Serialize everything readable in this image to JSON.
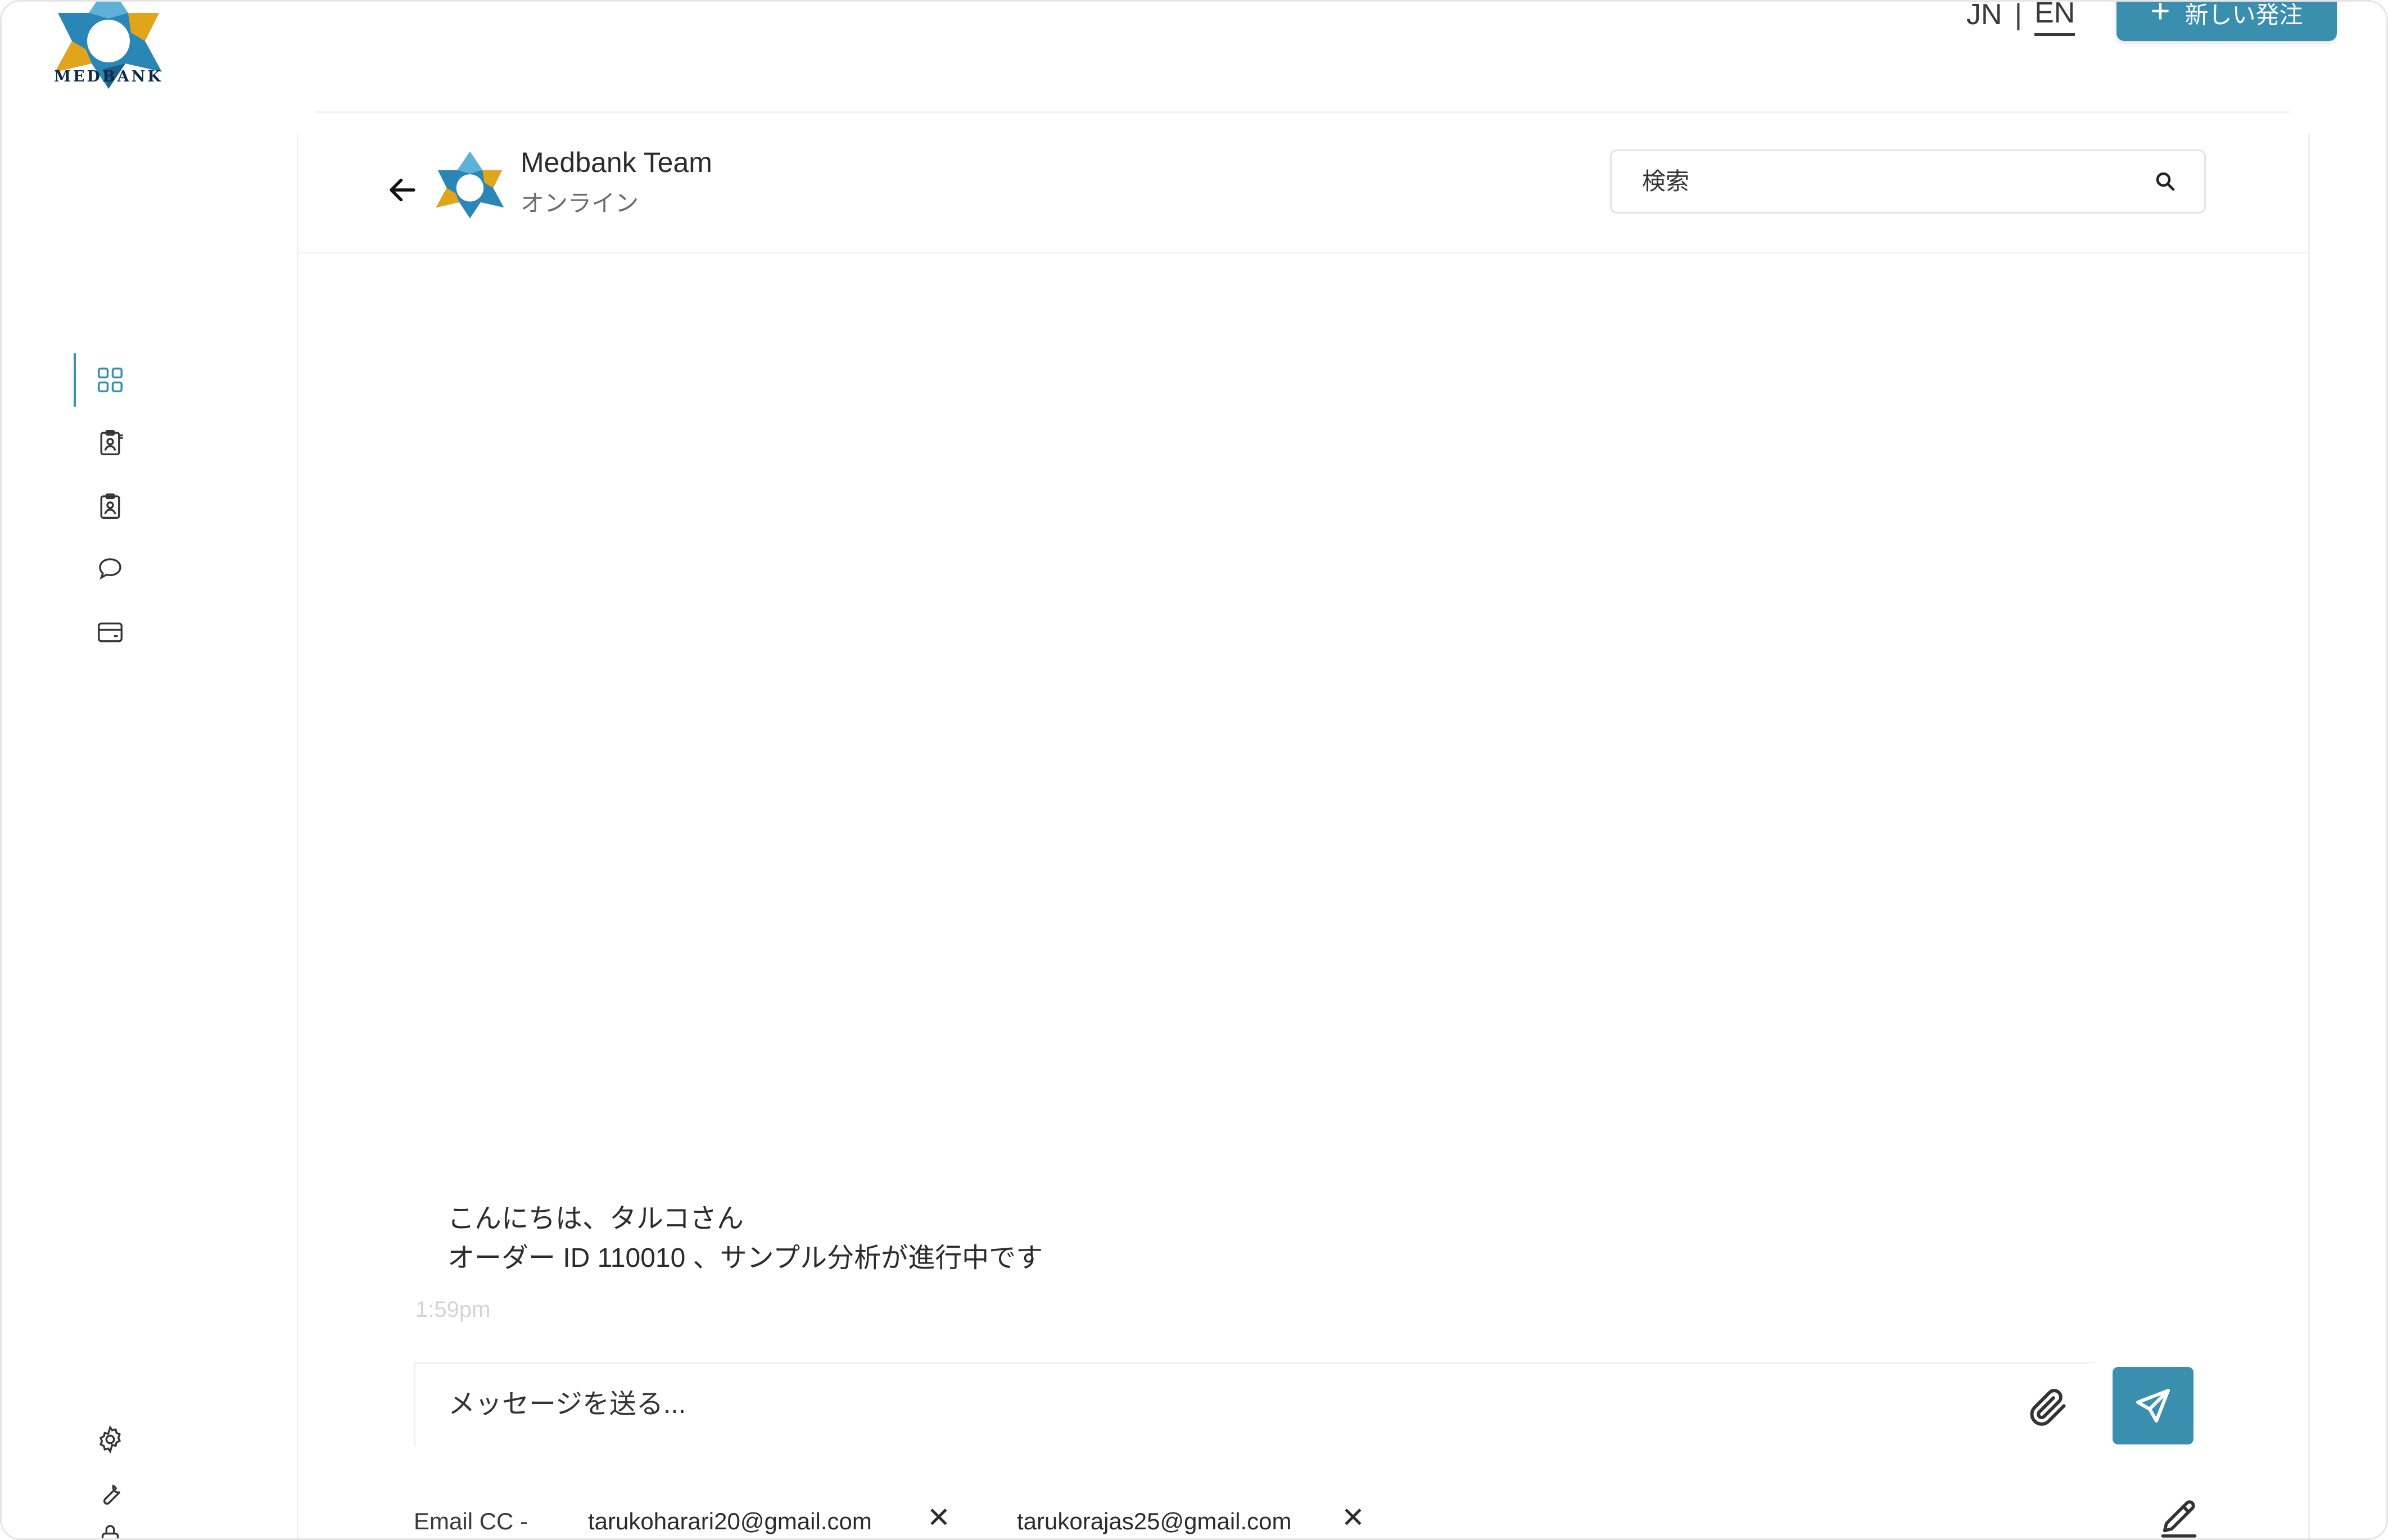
{
  "brand": {
    "logo_text": "MEDBANK",
    "accent_color": "#3a8fae",
    "gold_color": "#e0a51b"
  },
  "header": {
    "lang_jn": "JN",
    "lang_sep": "|",
    "lang_en": "EN",
    "active_lang": "EN",
    "new_order_label": "新しい発注",
    "new_order_icon": "plus-icon"
  },
  "sidebar": {
    "items": [
      {
        "name": "dashboard",
        "icon": "grid-icon",
        "active": true
      },
      {
        "name": "patients",
        "icon": "id-badge-icon",
        "active": false
      },
      {
        "name": "orders",
        "icon": "clipboard-user-icon",
        "active": false
      },
      {
        "name": "messages",
        "icon": "chat-bubble-icon",
        "active": false
      },
      {
        "name": "billing",
        "icon": "card-icon",
        "active": false
      }
    ],
    "bottom_items": [
      {
        "name": "settings",
        "icon": "gear-icon"
      },
      {
        "name": "tools",
        "icon": "wrench-icon"
      }
    ]
  },
  "chat": {
    "contact_name": "Medbank Team",
    "contact_status": "オンライン",
    "search_placeholder": "検索",
    "messages": [
      {
        "lines": [
          "こんにちは、タルコさん",
          "オーダー ID 110010 、サンプル分析が進行中です"
        ],
        "time": "1:59pm"
      }
    ],
    "composer_placeholder": "メッセージを送る...",
    "email_cc_label": "Email CC -",
    "cc_emails": [
      "tarukoharari20@gmail.com",
      "tarukorajas25@gmail.com"
    ],
    "remove_symbol": "✕"
  }
}
